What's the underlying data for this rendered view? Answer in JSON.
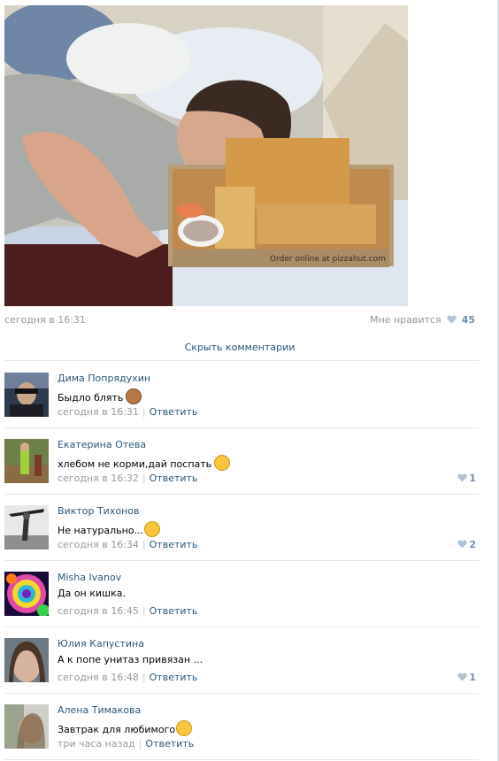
{
  "post": {
    "date": "сегодня в 16:31",
    "like_label": "Мне нравится",
    "like_count": "45"
  },
  "hide_comments": "Скрыть комментарии",
  "reply_label": "Ответить",
  "comments": [
    {
      "author": "Дима Попрядухин",
      "text": "Быдло блять",
      "emoji": "monkey-emoji",
      "time": "сегодня в 16:31",
      "likes": ""
    },
    {
      "author": "Екатерина Отева",
      "text": "хлебом не корми,дай поспать",
      "emoji": "grin-emoji",
      "time": "сегодня в 16:32",
      "likes": "1"
    },
    {
      "author": "Виктор Тихонов",
      "text": "Не натурально...",
      "emoji": "laugh-tears-emoji",
      "time": "сегодня в 16:34",
      "likes": "2"
    },
    {
      "author": "Misha Ivanov",
      "text": "Да он кишка.",
      "emoji": "",
      "time": "сегодня в 16:45",
      "likes": ""
    },
    {
      "author": "Юлия Капустина",
      "text": "А к попе унитаз привязан ...",
      "emoji": "",
      "time": "сегодня в 16:48",
      "likes": "1"
    },
    {
      "author": "Алена Тимакова",
      "text": "Завтрак для любимого",
      "emoji": "surprised-emoji",
      "time": "три часа назад",
      "likes": ""
    }
  ],
  "colors": {
    "link": "#2b587a",
    "muted": "#999999",
    "like_count": "#6d8fb3",
    "separator": "#e4e8ed"
  }
}
